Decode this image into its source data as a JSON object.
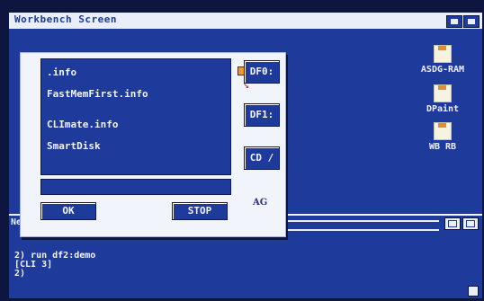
{
  "screen": {
    "title": "Workbench Screen"
  },
  "desktop": {
    "icons": [
      {
        "label": "ASDG-RAM",
        "icon": "disk-icon"
      },
      {
        "label": "DPaint",
        "icon": "disk-icon"
      },
      {
        "label": "WB RB",
        "icon": "disk-icon"
      }
    ]
  },
  "cli": {
    "title": "Ne",
    "lines": [
      "2) run df2:demo",
      "[CLI 3]",
      "2)"
    ]
  },
  "requester": {
    "files": [
      ".info",
      "FastMemFirst.info",
      "CLImate.info",
      "SmartDisk"
    ],
    "drives": [
      "DF0:",
      "DF1:",
      "CD /"
    ],
    "ok_label": "OK",
    "stop_label": "STOP",
    "ag_glyph": "AG"
  },
  "colors": {
    "screen_blue": "#1e3a9a",
    "title_white": "#e9eef8",
    "accent_orange": "#e79a2e"
  }
}
